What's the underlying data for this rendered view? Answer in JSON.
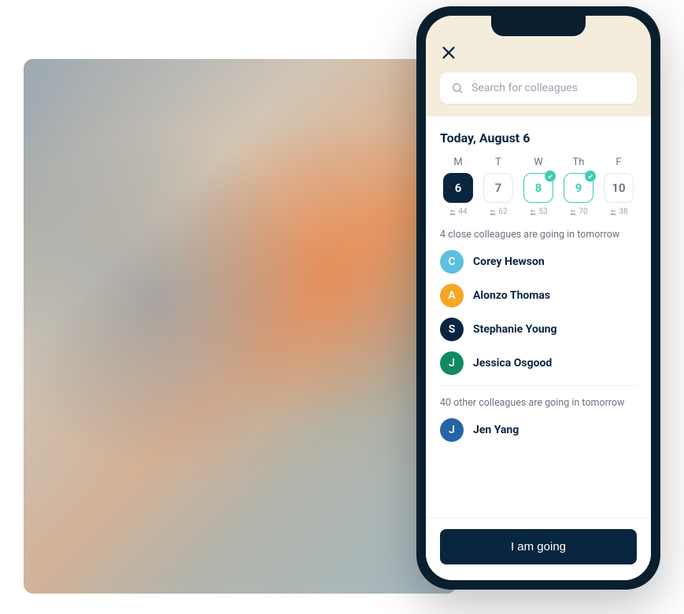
{
  "search": {
    "placeholder": "Search for colleagues"
  },
  "date_title": "Today, August 6",
  "week": [
    {
      "label": "M",
      "num": "6",
      "count": "44",
      "state": "selected"
    },
    {
      "label": "T",
      "num": "7",
      "count": "62",
      "state": "default"
    },
    {
      "label": "W",
      "num": "8",
      "count": "53",
      "state": "confirmed"
    },
    {
      "label": "Th",
      "num": "9",
      "count": "70",
      "state": "confirmed"
    },
    {
      "label": "F",
      "num": "10",
      "count": "38",
      "state": "default"
    }
  ],
  "close_section_label": "4 close colleagues are going in tomorrow",
  "close_colleagues": [
    {
      "initial": "C",
      "name": "Corey Hewson",
      "color": "#5bc0de"
    },
    {
      "initial": "A",
      "name": "Alonzo Thomas",
      "color": "#f5a623"
    },
    {
      "initial": "S",
      "name": "Stephanie Young",
      "color": "#0a2540"
    },
    {
      "initial": "J",
      "name": "Jessica Osgood",
      "color": "#0f8a5f"
    }
  ],
  "other_section_label": "40 other colleagues are going in tomorrow",
  "other_colleagues": [
    {
      "initial": "J",
      "name": "Jen Yang",
      "color": "#2563a8"
    }
  ],
  "cta_label": "I am going"
}
